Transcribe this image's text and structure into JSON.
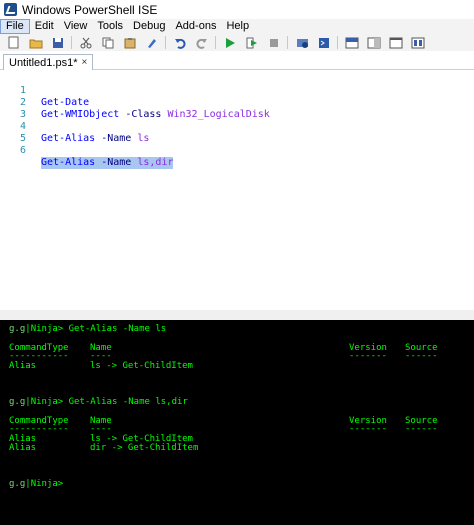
{
  "window": {
    "title": "Windows PowerShell ISE"
  },
  "menu": [
    "File",
    "Edit",
    "View",
    "Tools",
    "Debug",
    "Add-ons",
    "Help"
  ],
  "toolbar_icons": [
    "new-icon",
    "open-icon",
    "save-icon",
    "cut-icon",
    "copy-icon",
    "paste-icon",
    "clear-icon",
    "undo-icon",
    "redo-icon",
    "run-icon",
    "run-selection-icon",
    "stop-icon",
    "new-remote-tab-icon",
    "start-powershell-icon",
    "script-pane-top-icon",
    "script-pane-right-icon",
    "script-pane-maximized-icon",
    "show-command-icon"
  ],
  "tab": {
    "label": "Untitled1.ps1*",
    "close": "×"
  },
  "editor": {
    "lines": [
      {
        "num": "1",
        "cmd": "Get-Date",
        "param": "",
        "arg": ""
      },
      {
        "num": "2",
        "cmd": "Get-WMIObject",
        "param": "-Class",
        "arg": "Win32_LogicalDisk"
      },
      {
        "num": "3",
        "cmd": "",
        "param": "",
        "arg": ""
      },
      {
        "num": "4",
        "cmd": "Get-Alias",
        "param": "-Name",
        "arg": "ls"
      },
      {
        "num": "5",
        "cmd": "",
        "param": "",
        "arg": ""
      },
      {
        "num": "6",
        "cmd": "Get-Alias",
        "param": "-Name",
        "arg": "ls,dir"
      }
    ]
  },
  "console": {
    "prompt_user": "g",
    "prompt_host": "g",
    "prompt_name": "Ninja",
    "prompt_end": ">",
    "cmd1": "Get-Alias -Name ls",
    "headers": {
      "type": "CommandType",
      "name": "Name",
      "version": "Version",
      "source": "Source"
    },
    "dashes": {
      "type": "-----------",
      "name": "----",
      "version": "-------",
      "source": "------"
    },
    "result1": [
      {
        "type": "Alias",
        "name": "ls -> Get-ChildItem"
      }
    ],
    "cmd2": "Get-Alias -Name ls,dir",
    "result2": [
      {
        "type": "Alias",
        "name": "ls -> Get-ChildItem"
      },
      {
        "type": "Alias",
        "name": "dir -> Get-ChildItem"
      }
    ]
  },
  "colors": {
    "console_bg": "#000000",
    "console_text": "#00ff00",
    "selection": "#a8c7f0",
    "line_number": "#2b91af"
  }
}
